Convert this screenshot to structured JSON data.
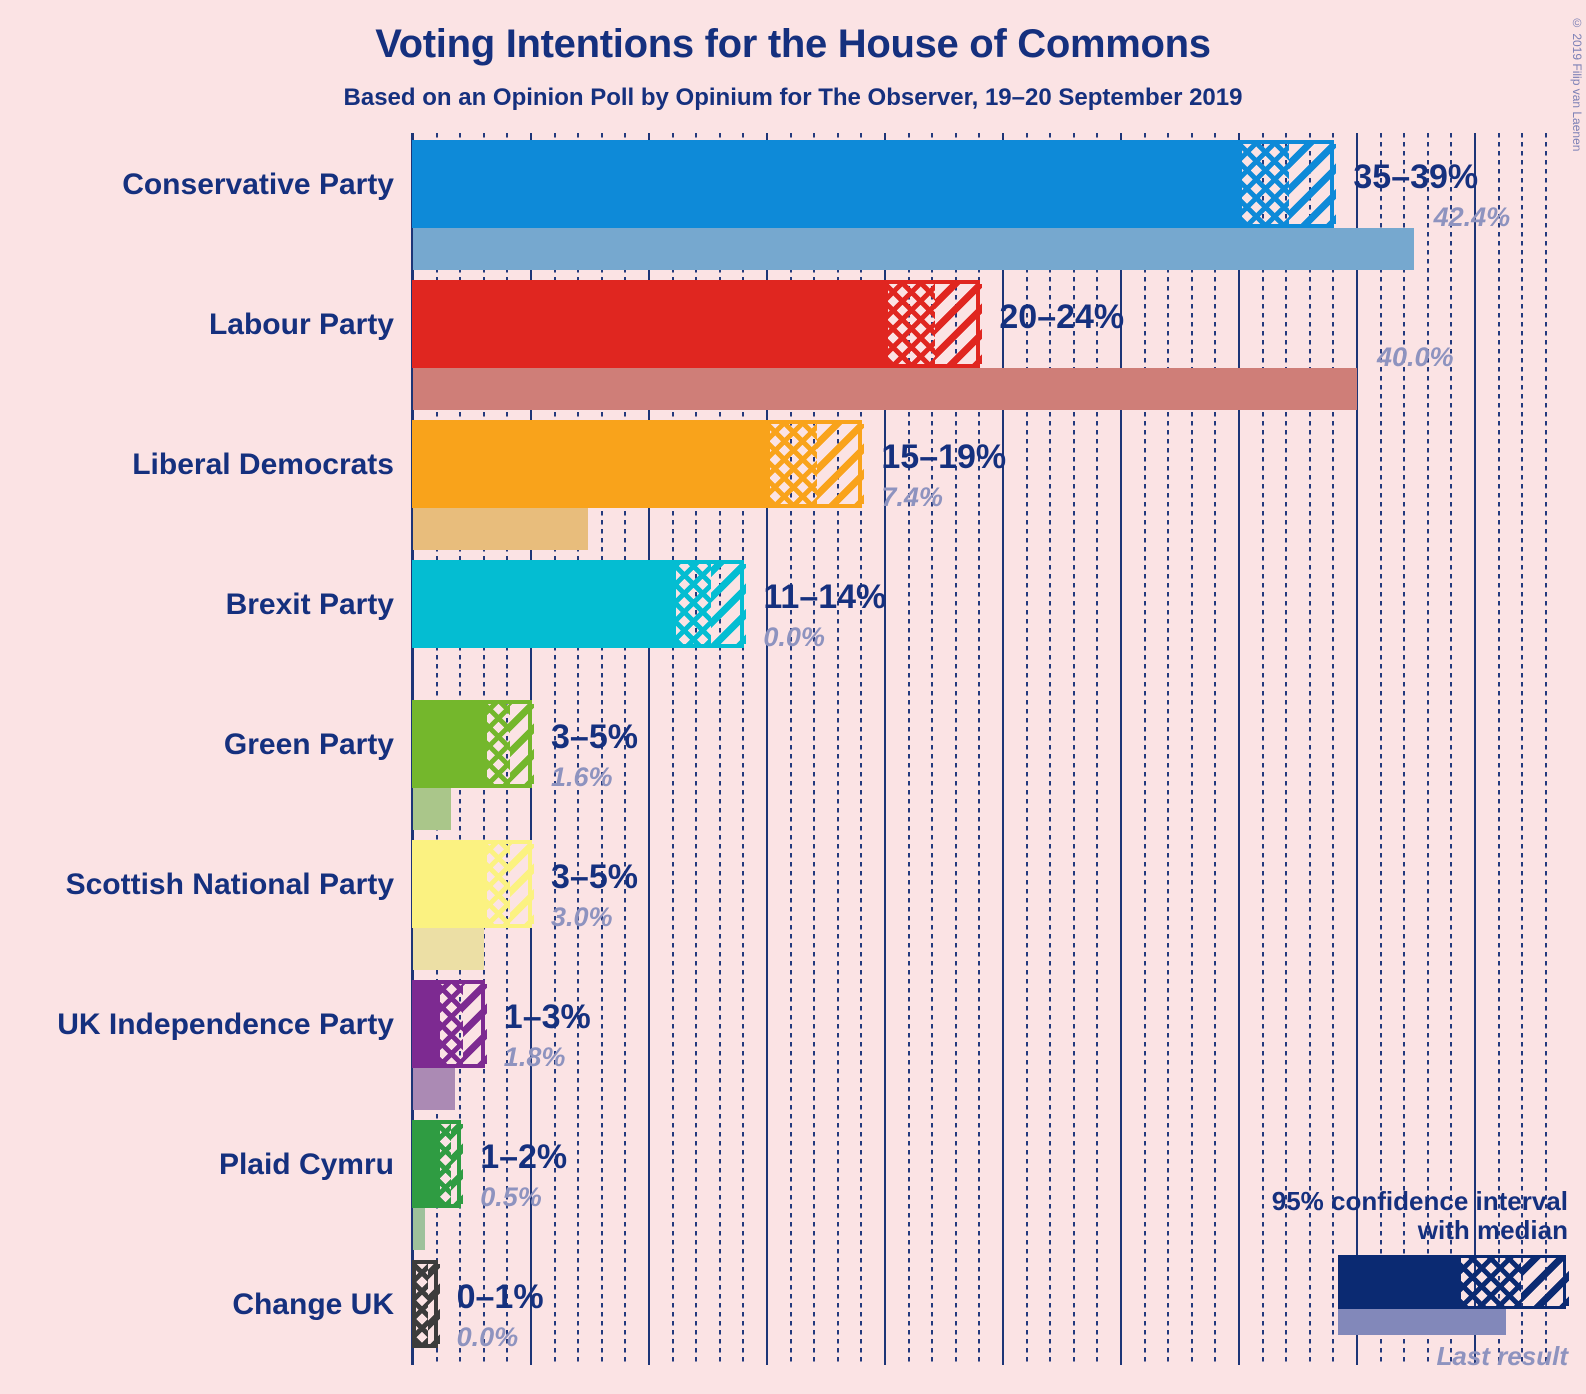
{
  "header": {
    "title": "Voting Intentions for the House of Commons",
    "subtitle": "Based on an Opinion Poll by Opinium for The Observer, 19–20 September 2019",
    "copyright": "© 2019 Filip van Laenen"
  },
  "legend": {
    "line1": "95% confidence interval",
    "line2": "with median",
    "last_result_label": "Last result",
    "swatch_color": "#0b2a72",
    "last_result_color": "#8288ba"
  },
  "axis": {
    "origin_percent": 0,
    "max_percent": 48,
    "major_step_percent": 5,
    "minor_step_percent": 1,
    "grid_color": "#1d3577"
  },
  "chart_data": {
    "type": "bar",
    "title": "Voting Intentions for the House of Commons",
    "subtitle": "Based on an Opinion Poll by Opinium for The Observer, 19–20 September 2019",
    "xlabel": "",
    "ylabel": "",
    "xlim": [
      0,
      48
    ],
    "grid": true,
    "orientation": "horizontal",
    "legend_position": "bottom-right",
    "value_unit": "%",
    "categories": [
      "Conservative Party",
      "Labour Party",
      "Liberal Democrats",
      "Brexit Party",
      "Green Party",
      "Scottish National Party",
      "UK Independence Party",
      "Plaid Cymru",
      "Change UK"
    ],
    "series": [
      {
        "name": "95% confidence interval with median",
        "values": [
          {
            "low": 35,
            "median": 37,
            "high": 39
          },
          {
            "low": 20,
            "median": 22,
            "high": 24
          },
          {
            "low": 15,
            "median": 17,
            "high": 19
          },
          {
            "low": 11,
            "median": 12.5,
            "high": 14
          },
          {
            "low": 3,
            "median": 4,
            "high": 5
          },
          {
            "low": 3,
            "median": 4,
            "high": 5
          },
          {
            "low": 1,
            "median": 2,
            "high": 3
          },
          {
            "low": 1,
            "median": 1.5,
            "high": 2
          },
          {
            "low": 0,
            "median": 0.5,
            "high": 1
          }
        ]
      },
      {
        "name": "Last result",
        "values": [
          42.4,
          40.0,
          7.4,
          0.0,
          1.6,
          3.0,
          1.8,
          0.5,
          0.0
        ]
      }
    ]
  },
  "rows": [
    {
      "party": "Conservative Party",
      "ci_label": "35–39%",
      "last_label": "42.4%",
      "low": 35,
      "median": 37,
      "high": 39,
      "last": 42.4,
      "color": "#0e8ad8",
      "last_color": "#76a8cf"
    },
    {
      "party": "Labour Party",
      "ci_label": "20–24%",
      "last_label": "40.0%",
      "low": 20,
      "median": 22,
      "high": 24,
      "last": 40.0,
      "color": "#e02620",
      "last_color": "#cf7e78"
    },
    {
      "party": "Liberal Democrats",
      "ci_label": "15–19%",
      "last_label": "7.4%",
      "low": 15,
      "median": 17,
      "high": 19,
      "last": 7.4,
      "color": "#f9a31b",
      "last_color": "#e8bd7c"
    },
    {
      "party": "Brexit Party",
      "ci_label": "11–14%",
      "last_label": "0.0%",
      "low": 11,
      "median": 12.5,
      "high": 14,
      "last": 0.0,
      "color": "#04bdd2",
      "last_color": "#8fcdd5"
    },
    {
      "party": "Green Party",
      "ci_label": "3–5%",
      "last_label": "1.6%",
      "low": 3,
      "median": 4,
      "high": 5,
      "last": 1.6,
      "color": "#74b72c",
      "last_color": "#aac68a"
    },
    {
      "party": "Scottish National Party",
      "ci_label": "3–5%",
      "last_label": "3.0%",
      "low": 3,
      "median": 4,
      "high": 5,
      "last": 3.0,
      "color": "#fbf281",
      "last_color": "#ecdfa5"
    },
    {
      "party": "UK Independence Party",
      "ci_label": "1–3%",
      "last_label": "1.8%",
      "low": 1,
      "median": 2,
      "high": 3,
      "last": 1.8,
      "color": "#7d2a91",
      "last_color": "#ab8ab4"
    },
    {
      "party": "Plaid Cymru",
      "ci_label": "1–2%",
      "last_label": "0.5%",
      "low": 1,
      "median": 1.5,
      "high": 2,
      "last": 0.5,
      "color": "#2f9c42",
      "last_color": "#9ec19b"
    },
    {
      "party": "Change UK",
      "ci_label": "0–1%",
      "last_label": "0.0%",
      "low": 0,
      "median": 0.5,
      "high": 1,
      "last": 0.0,
      "color": "#3c3c3c",
      "last_color": "#9a9a9a"
    }
  ]
}
